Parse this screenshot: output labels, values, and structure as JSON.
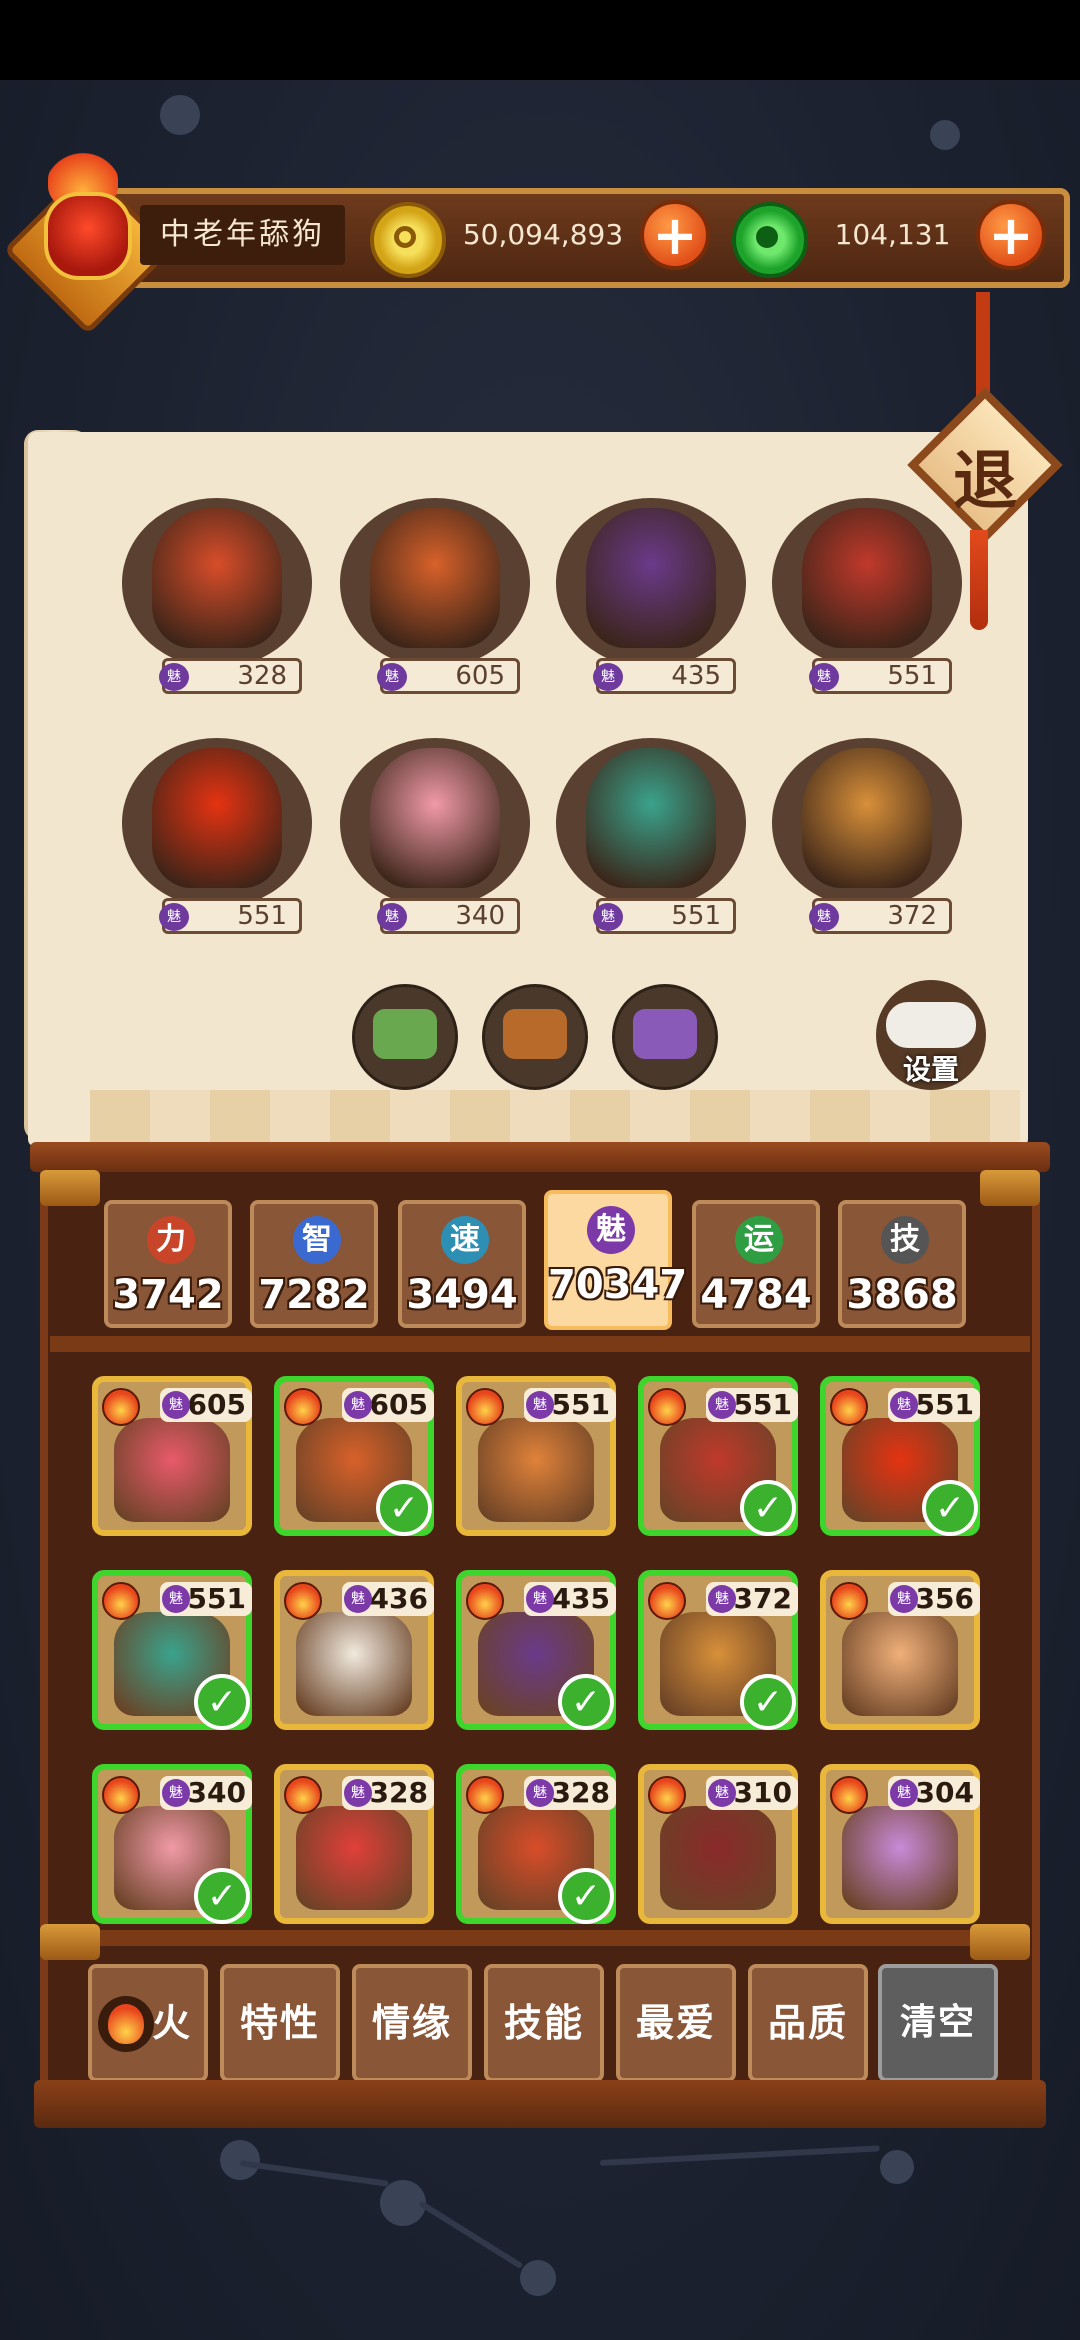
{
  "player": {
    "name": "中老年舔狗"
  },
  "currency": {
    "gold": {
      "icon": "gold-coin-icon",
      "amount": "50,094,893"
    },
    "jade": {
      "icon": "jade-coin-icon",
      "amount": "104,131"
    }
  },
  "exit_label": "退",
  "display": {
    "slots": [
      {
        "stat": "魅",
        "value": "328",
        "color": "#d84d2a"
      },
      {
        "stat": "魅",
        "value": "605",
        "color": "#d8612a"
      },
      {
        "stat": "魅",
        "value": "435",
        "color": "#6a3a8a"
      },
      {
        "stat": "魅",
        "value": "551",
        "color": "#c0392b"
      },
      {
        "stat": "魅",
        "value": "551",
        "color": "#e53312"
      },
      {
        "stat": "魅",
        "value": "340",
        "color": "#f19aa8"
      },
      {
        "stat": "魅",
        "value": "551",
        "color": "#3aa38c"
      },
      {
        "stat": "魅",
        "value": "372",
        "color": "#d8903a"
      }
    ],
    "food_items": [
      "food-bowl-icon",
      "food-basket-icon",
      "purple-cake-icon"
    ],
    "settings_label": "设置"
  },
  "stats": [
    {
      "label": "力",
      "value": "3742",
      "color": "#c8452a",
      "active": false
    },
    {
      "label": "智",
      "value": "7282",
      "color": "#3a6ad0",
      "active": false
    },
    {
      "label": "速",
      "value": "3494",
      "color": "#2e8fb5",
      "active": false
    },
    {
      "label": "魅",
      "value": "70347",
      "color": "#7b3aa8",
      "active": true
    },
    {
      "label": "运",
      "value": "4784",
      "color": "#2f9e42",
      "active": false
    },
    {
      "label": "技",
      "value": "3868",
      "color": "#555555",
      "active": false
    }
  ],
  "heroes": [
    {
      "value": "605",
      "selected": false,
      "color": "#e85a6a"
    },
    {
      "value": "605",
      "selected": true,
      "color": "#d8612a"
    },
    {
      "value": "551",
      "selected": false,
      "color": "#e0823a"
    },
    {
      "value": "551",
      "selected": true,
      "color": "#c0392b"
    },
    {
      "value": "551",
      "selected": true,
      "color": "#e53312"
    },
    {
      "value": "551",
      "selected": true,
      "color": "#3aa38c"
    },
    {
      "value": "436",
      "selected": false,
      "color": "#f1eadf"
    },
    {
      "value": "435",
      "selected": true,
      "color": "#6a3a8a"
    },
    {
      "value": "372",
      "selected": true,
      "color": "#d8903a"
    },
    {
      "value": "356",
      "selected": false,
      "color": "#f0b07a"
    },
    {
      "value": "340",
      "selected": true,
      "color": "#f19aa8"
    },
    {
      "value": "328",
      "selected": false,
      "color": "#e0403a"
    },
    {
      "value": "328",
      "selected": true,
      "color": "#d84d2a"
    },
    {
      "value": "310",
      "selected": false,
      "color": "#8a2a2a"
    },
    {
      "value": "304",
      "selected": false,
      "color": "#c88ad8"
    }
  ],
  "hero_stat_icon": "魅",
  "filters": {
    "fire": "火",
    "trait": "特性",
    "bond": "情缘",
    "skill": "技能",
    "favorite": "最爱",
    "quality": "品质",
    "clear": "清空"
  }
}
